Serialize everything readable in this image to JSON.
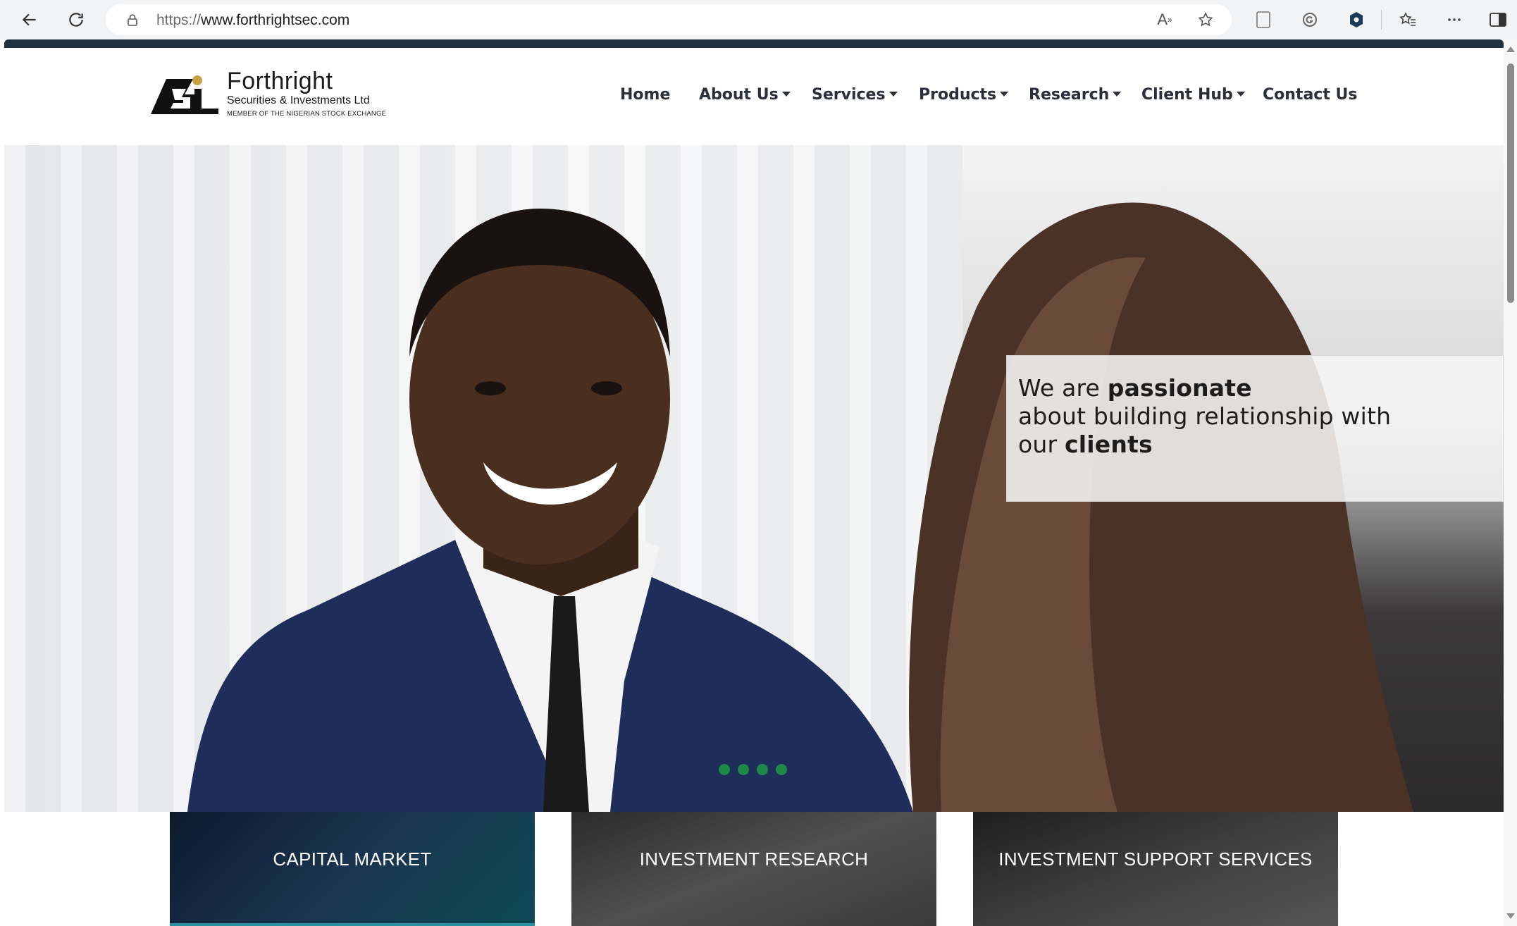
{
  "browser": {
    "url_protocol": "https://",
    "url_host": "www.forthrightsec.com"
  },
  "logo": {
    "name": "Forthright",
    "subtitle": "Securities & Investments Ltd",
    "member": "MEMBER OF THE NIGERIAN STOCK EXCHANGE"
  },
  "nav": {
    "items": [
      {
        "label": "Home",
        "dropdown": false
      },
      {
        "label": "About Us",
        "dropdown": true
      },
      {
        "label": "Services",
        "dropdown": true
      },
      {
        "label": "Products",
        "dropdown": true
      },
      {
        "label": "Research",
        "dropdown": true
      },
      {
        "label": "Client Hub",
        "dropdown": true
      },
      {
        "label": "Contact Us",
        "dropdown": false
      }
    ]
  },
  "hero": {
    "line1_plain": "We are ",
    "line1_bold": "passionate",
    "line2": "about building relationship with",
    "line3_plain": "our ",
    "line3_bold": "clients",
    "slide_count": 4,
    "dot_color": "#1e8a4a"
  },
  "tiles": [
    {
      "label": "CAPITAL MARKET"
    },
    {
      "label": "INVESTMENT RESEARCH"
    },
    {
      "label": "INVESTMENT SUPPORT SERVICES"
    }
  ],
  "colors": {
    "nav_text": "#2a2f3a",
    "top_strip": "#1f3344"
  }
}
